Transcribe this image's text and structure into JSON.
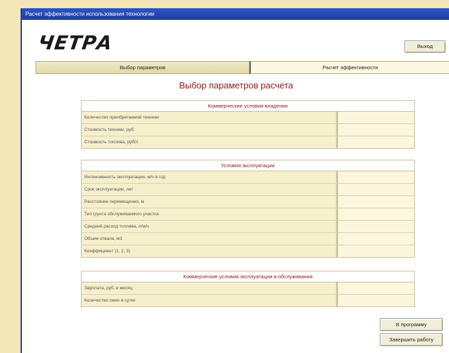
{
  "window": {
    "title": "Расчет эффективности использования технологии"
  },
  "logo": {
    "text": "ЧЕТРА"
  },
  "header": {
    "exit_label": "Выход"
  },
  "tabs": [
    {
      "label": "Выбор параметров"
    },
    {
      "label": "Расчет эффективности"
    }
  ],
  "main": {
    "title": "Выбор параметров расчета"
  },
  "groups": [
    {
      "title": "Коммерческие условия владения",
      "rows": [
        {
          "label": "Количество приобретаемой техники",
          "value": ""
        },
        {
          "label": "Стоимость техники, руб.",
          "value": ""
        },
        {
          "label": "Стоимость топлива, руб/л",
          "value": ""
        }
      ]
    },
    {
      "title": "Условия эксплуатации",
      "rows": [
        {
          "label": "Интенсивность эксплуатации, м/ч в год",
          "value": ""
        },
        {
          "label": "Срок эксплуатации, лет",
          "value": ""
        },
        {
          "label": "Расстояние перемещения, м",
          "value": ""
        },
        {
          "label": "Тип грунта обслуживаемого участка",
          "value": ""
        },
        {
          "label": "Средний расход топлива, л/м/ч",
          "value": ""
        },
        {
          "label": "Объем отвала, м3",
          "value": ""
        },
        {
          "label": "Коэффициент (1, 2, 3)",
          "value": ""
        }
      ]
    },
    {
      "title": "Коммерческие условия эксплуатации и обслуживания",
      "rows": [
        {
          "label": "Зарплата, руб. в месяц",
          "value": ""
        },
        {
          "label": "Количество смен в сутки",
          "value": ""
        }
      ]
    }
  ],
  "actions": {
    "primary_label": "В программу",
    "secondary_label": "Завершить работу"
  }
}
